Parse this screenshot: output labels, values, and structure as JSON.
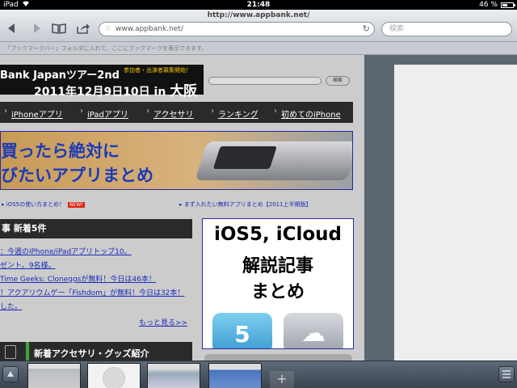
{
  "statusbar": {
    "carrier": "iPad",
    "time": "21:48",
    "battery": "46 %",
    "battery_level": 0.46
  },
  "toolbar": {
    "page_title": "http://www.appbank.net/",
    "url": "www.appbank.net/",
    "search_placeholder": "検索",
    "bookmark_hint": "「ブックマークバー」フォルダに入れて、ここにブックマークを表示できます。"
  },
  "webpage": {
    "banner": {
      "line1": "Bank Japanツアー2nd",
      "tag": "参加者・出演者募集開始！",
      "date": "2011年12月9日10日 in ",
      "city": "大阪"
    },
    "search_button": "検索",
    "nav": [
      "iPhoneアプリ",
      "iPadアプリ",
      "アクセサリ",
      "ランキング",
      "初めてのiPhone"
    ],
    "hero": {
      "line1": "買ったら絶対に",
      "line2": "びたいアプリまとめ"
    },
    "links": {
      "link1": "▸ iOS5の使い方まとめ！",
      "new_badge": "NEW!",
      "link2": "▸ まず入れたい無料アプリまとめ【2011上半期版】"
    },
    "news_header": "事  新着5件",
    "news_items": [
      "：今週のiPhone/iPadアプリトップ10。",
      "ゼント。9名様。",
      "Time Geeks: Cloneggsが無料！今日は46本！",
      "！アクアリウムゲー「Fishdom」が無料！今日は32本！",
      "した。"
    ],
    "more_link": "もっと見る>>",
    "ad": {
      "line1": "iOS5, iCloud",
      "line2": "解説記事",
      "line3": "まとめ",
      "icon_5": "5",
      "icon_cloud": "☁"
    },
    "goods_header": "新着アクセサリ・グッズ紹介"
  },
  "tabbar": {
    "add_tab": "+"
  }
}
